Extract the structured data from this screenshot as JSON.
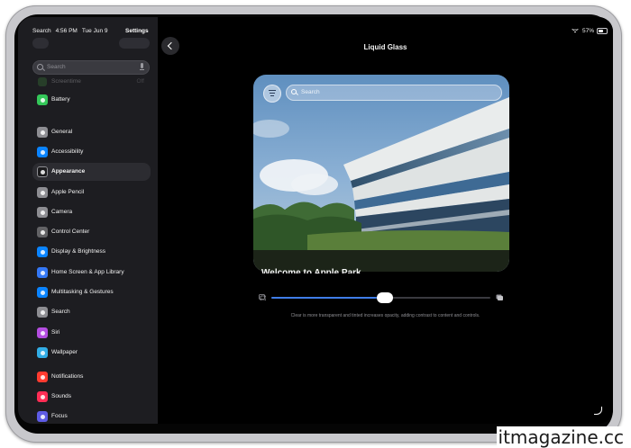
{
  "status_bar": {
    "signal": "Search",
    "time": "4:56 PM",
    "date": "Tue Jun 9",
    "battery": "57%"
  },
  "sidebar": {
    "title": "Settings",
    "search_placeholder": "Search",
    "faded_item": {
      "label": "Screentime",
      "value": "Off"
    },
    "items": [
      {
        "label": "Battery",
        "icon": "battery-icon",
        "color": "#34c759"
      },
      {
        "label": "General",
        "icon": "gear-icon",
        "color": "#8e8e93"
      },
      {
        "label": "Accessibility",
        "icon": "accessibility-icon",
        "color": "#0a84ff"
      },
      {
        "label": "Appearance",
        "icon": "appearance-icon",
        "color": "#1c1c1e",
        "selected": true
      },
      {
        "label": "Apple Pencil",
        "icon": "pencil-icon",
        "color": "#8e8e93"
      },
      {
        "label": "Camera",
        "icon": "camera-icon",
        "color": "#8e8e93"
      },
      {
        "label": "Control Center",
        "icon": "control-center-icon",
        "color": "#636366"
      },
      {
        "label": "Display & Brightness",
        "icon": "brightness-icon",
        "color": "#0a84ff"
      },
      {
        "label": "Home Screen & App Library",
        "icon": "home-screen-icon",
        "color": "#3478f6"
      },
      {
        "label": "Multitasking & Gestures",
        "icon": "multitasking-icon",
        "color": "#0a84ff"
      },
      {
        "label": "Search",
        "icon": "search-icon",
        "color": "#8e8e93"
      },
      {
        "label": "Siri",
        "icon": "siri-icon",
        "color": "#b44de0"
      },
      {
        "label": "Wallpaper",
        "icon": "wallpaper-icon",
        "color": "#32ade6"
      },
      {
        "label": "Notifications",
        "icon": "notifications-icon",
        "color": "#ff3b30"
      },
      {
        "label": "Sounds",
        "icon": "sounds-icon",
        "color": "#ff2d55"
      },
      {
        "label": "Focus",
        "icon": "focus-icon",
        "color": "#5e5ce6"
      }
    ]
  },
  "detail": {
    "title": "Liquid Glass",
    "preview": {
      "search_placeholder": "Search",
      "caption": "Welcome to Apple Park"
    },
    "slider": {
      "value": 0.52,
      "min_icon": "clear-glass-icon",
      "max_icon": "tinted-glass-icon",
      "accent": "#3f7de8"
    },
    "footnote": "Clear is more transparent and tinted increases opacity, adding contrast to content and controls."
  },
  "watermark": "itmagazine.cc"
}
